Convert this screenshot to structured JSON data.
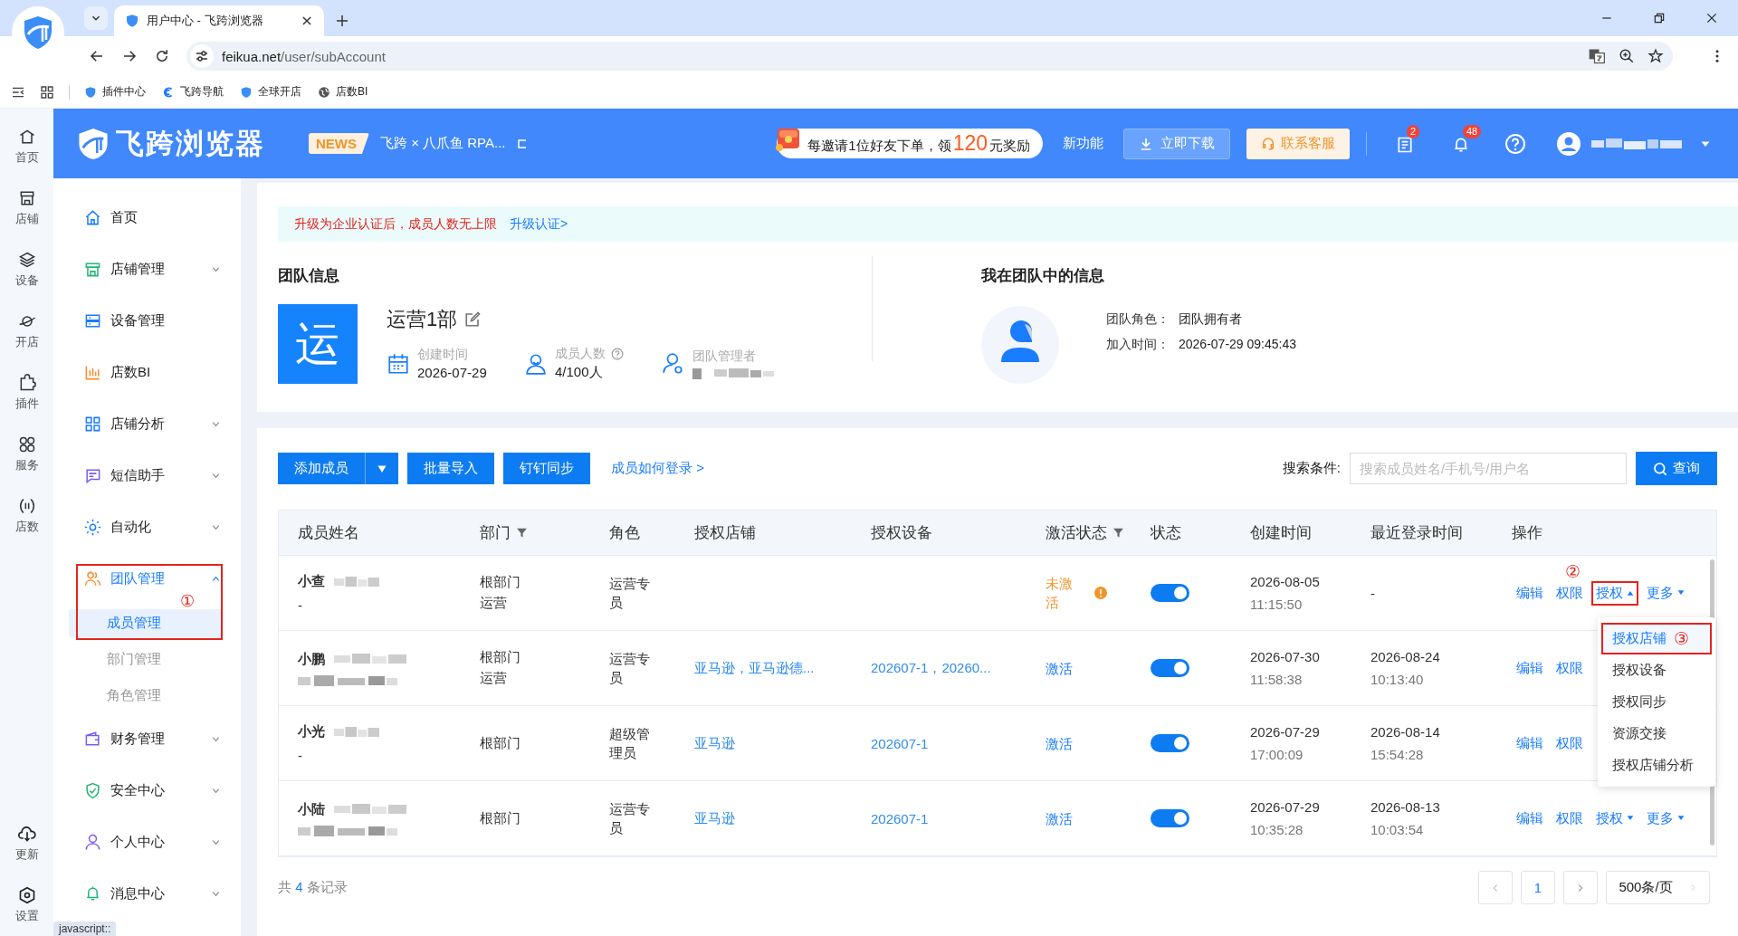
{
  "browser": {
    "tab_title": "用户中心 - 飞跨浏览器",
    "url_host": "feikua.net",
    "url_path": "/user/subAccount",
    "bookmarks": [
      "插件中心",
      "飞跨导航",
      "全球开店",
      "店数BI"
    ]
  },
  "header": {
    "logo": "飞跨浏览器",
    "news_badge": "NEWS",
    "news_text": "飞跨 × 八爪鱼 RPA...",
    "promo_pre": "每邀请1位好友下单，领",
    "promo_amount": "120",
    "promo_post": "元奖励",
    "new_features": "新功能",
    "download": "立即下载",
    "contact": "联系客服",
    "message_count": "2",
    "notice_count": "48"
  },
  "rail": {
    "items": [
      "首页",
      "店铺",
      "设备",
      "开店",
      "插件",
      "服务",
      "店数"
    ],
    "bottom": [
      "更新",
      "设置"
    ]
  },
  "sidebar": {
    "items": [
      {
        "label": "首页",
        "kind": "link",
        "selected": false
      },
      {
        "label": "店铺管理",
        "kind": "group",
        "expanded": false,
        "selected": false
      },
      {
        "label": "设备管理",
        "kind": "link",
        "selected": false
      },
      {
        "label": "店数BI",
        "kind": "link",
        "selected": false
      },
      {
        "label": "店铺分析",
        "kind": "group",
        "expanded": false,
        "selected": false
      },
      {
        "label": "短信助手",
        "kind": "group",
        "expanded": false,
        "selected": false
      },
      {
        "label": "自动化",
        "kind": "group",
        "expanded": false,
        "selected": false
      },
      {
        "label": "团队管理",
        "kind": "group",
        "expanded": true,
        "selected": true,
        "annotation": "①",
        "children": [
          {
            "label": "成员管理",
            "selected": true
          },
          {
            "label": "部门管理",
            "selected": false
          },
          {
            "label": "角色管理",
            "selected": false
          }
        ]
      },
      {
        "label": "财务管理",
        "kind": "group",
        "expanded": false,
        "selected": false
      },
      {
        "label": "安全中心",
        "kind": "group",
        "expanded": false,
        "selected": false
      },
      {
        "label": "个人中心",
        "kind": "group",
        "expanded": false,
        "selected": false
      },
      {
        "label": "消息中心",
        "kind": "group",
        "expanded": false,
        "selected": false
      }
    ]
  },
  "notice": {
    "text": "升级为企业认证后，成员人数无上限",
    "link": "升级认证>"
  },
  "team": {
    "title": "团队信息",
    "avatar": "运",
    "name": "运营1部",
    "stats": [
      {
        "label": "创建时间",
        "kind": "text",
        "value": "2026-07-29"
      },
      {
        "label": "成员人数",
        "kind": "text",
        "value": "4/100人",
        "help": true
      },
      {
        "label": "团队管理者",
        "kind": "redacted"
      }
    ]
  },
  "me": {
    "title": "我在团队中的信息",
    "fields": [
      {
        "label": "团队角色：",
        "value": "团队拥有者"
      },
      {
        "label": "加入时间：",
        "value": "2026-07-29 09:45:43"
      }
    ]
  },
  "toolbar": {
    "add": "添加成员",
    "buttons": [
      "批量导入",
      "钉钉同步"
    ],
    "help_link": "成员如何登录 >",
    "search_label": "搜索条件:",
    "search_placeholder": "搜索成员姓名/手机号/用户名",
    "search_button": "查询"
  },
  "table": {
    "columns": [
      {
        "label": "成员姓名"
      },
      {
        "label": "部门",
        "filter": true
      },
      {
        "label": "角色"
      },
      {
        "label": "授权店铺"
      },
      {
        "label": "授权设备"
      },
      {
        "label": "激活状态",
        "filter": true
      },
      {
        "label": "状态"
      },
      {
        "label": "创建时间"
      },
      {
        "label": "最近登录时间"
      },
      {
        "label": "操作"
      }
    ],
    "rows": [
      {
        "name": "小查",
        "account": "-",
        "depts": [
          "根部门",
          "运营"
        ],
        "role": "运营专员",
        "activation": "未激活",
        "activated": false,
        "on": true,
        "created_date": "2026-08-05",
        "created_time": "11:15:50",
        "login_date": "-",
        "ops": [
          {
            "label": "编辑",
            "kind": "link"
          },
          {
            "label": "权限",
            "kind": "link"
          },
          {
            "label": "授权",
            "kind": "dropdown",
            "expanded": true,
            "annotation": "②"
          },
          {
            "label": "更多",
            "kind": "dropdown",
            "expanded": false
          }
        ]
      },
      {
        "name": "小鹏",
        "depts": [
          "根部门",
          "运营"
        ],
        "role": "运营专员",
        "stores": "亚马逊，亚马逊德...",
        "devices": "202607-1，20260...",
        "activation": "激活",
        "activated": true,
        "on": true,
        "created_date": "2026-07-30",
        "created_time": "11:58:38",
        "login_date": "2026-08-24",
        "login_time": "10:13:40",
        "ops": [
          {
            "label": "编辑",
            "kind": "link"
          },
          {
            "label": "权限",
            "kind": "link"
          }
        ]
      },
      {
        "name": "小光",
        "account": "-",
        "depts": [
          "根部门"
        ],
        "role": "超级管理员",
        "stores": "亚马逊",
        "devices": "202607-1",
        "activation": "激活",
        "activated": true,
        "on": true,
        "created_date": "2026-07-29",
        "created_time": "17:00:09",
        "login_date": "2026-08-14",
        "login_time": "15:54:28",
        "ops": [
          {
            "label": "编辑",
            "kind": "link"
          },
          {
            "label": "权限",
            "kind": "link"
          }
        ]
      },
      {
        "name": "小陆",
        "depts": [
          "根部门"
        ],
        "role": "运营专员",
        "stores": "亚马逊",
        "devices": "202607-1",
        "activation": "激活",
        "activated": true,
        "on": true,
        "created_date": "2026-07-29",
        "created_time": "10:35:28",
        "login_date": "2026-08-13",
        "login_time": "10:03:54",
        "ops": [
          {
            "label": "编辑",
            "kind": "link"
          },
          {
            "label": "权限",
            "kind": "link"
          },
          {
            "label": "授权",
            "kind": "dropdown",
            "expanded": false
          },
          {
            "label": "更多",
            "kind": "dropdown",
            "expanded": false
          }
        ]
      }
    ]
  },
  "menu": {
    "items": [
      {
        "label": "授权店铺",
        "selected": true,
        "annotation": "③"
      },
      {
        "label": "授权设备",
        "selected": false
      },
      {
        "label": "授权同步",
        "selected": false
      },
      {
        "label": "资源交接",
        "selected": false
      },
      {
        "label": "授权店铺分析",
        "selected": false
      }
    ]
  },
  "footer": {
    "total_pre": "共",
    "total": "4",
    "total_post": "条记录",
    "pages": [
      {
        "label": "1",
        "selected": true
      }
    ],
    "page_size": "500条/页"
  },
  "status_bar": "javascript::"
}
